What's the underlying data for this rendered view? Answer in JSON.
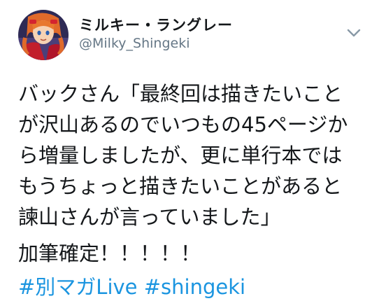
{
  "author": {
    "display_name": "ミルキー・ラングレー",
    "handle": "@Milky_Shingeki"
  },
  "icons": {
    "avatar": "avatar-image",
    "menu": "chevron-down-icon"
  },
  "tweet": {
    "lines": [
      "バックさん「最終回は描きたいこと",
      "が沢山あるのでいつもの45ページか",
      "ら増量しましたが、更に単行本では",
      "もうちょっと描きたいことがあると",
      "諫山さんが言っていました」",
      "加筆確定！！！！！"
    ],
    "hashtags": [
      "#別マガLive",
      "#shingeki"
    ]
  },
  "colors": {
    "text": "#14171a",
    "secondary_text": "#657786",
    "link": "#1b95e0"
  }
}
